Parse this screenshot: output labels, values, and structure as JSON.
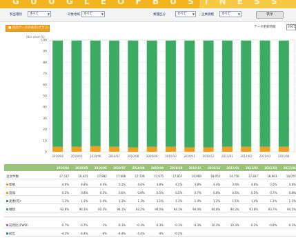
{
  "banner": {
    "text": "G U U G L E   O F   B U S I N E S S"
  },
  "filters": {
    "f1": {
      "label": "製品種別",
      "value": "すべて"
    },
    "f2": {
      "label": "対象地域",
      "value": "すべて"
    },
    "f3": {
      "label": "業種区分",
      "value": "すべて"
    },
    "f4": {
      "label": "企業規模",
      "value": "すべて"
    },
    "display_button": "表示"
  },
  "toolbar": {
    "orange_button": "■ 月次データの表示(グラフ)",
    "update_label": "データ更新時間",
    "update_value": "2015"
  },
  "chart_unit": "(Bar chart %)",
  "chart_data": {
    "type": "bar",
    "stacked": true,
    "categories": [
      "2010/04",
      "2010/05",
      "2010/06",
      "2010/07",
      "2010/08",
      "2010/09",
      "2010/10",
      "2010/11",
      "2010/12",
      "2011/01",
      "2011/02",
      "2011/03",
      "2011/04"
    ],
    "ylim": [
      0,
      100
    ],
    "yticks": [
      "100",
      "90",
      "80",
      "70",
      "60",
      "50",
      "40",
      "30",
      "20",
      "10",
      "0"
    ],
    "series": [
      {
        "name": "",
        "color": "#3cab63",
        "values": [
          95,
          95,
          94.5,
          95,
          95.5,
          95,
          95,
          95.5,
          95.5,
          95,
          95,
          95,
          95
        ]
      },
      {
        "name": "",
        "color": "#f0a020",
        "values": [
          4.5,
          4.5,
          5,
          4.5,
          4,
          4.5,
          4.5,
          4,
          4,
          4.5,
          4.5,
          4.5,
          4.5
        ]
      }
    ]
  },
  "table": {
    "columns": [
      "2010/04",
      "2010/05",
      "2010/06",
      "2010/07",
      "2010/08",
      "2010/09",
      "2010/10",
      "2010/11",
      "2010/12",
      "2011/01",
      "2011/02",
      "2011/03",
      "2011/04"
    ],
    "rows": [
      {
        "label": "注文件数",
        "dot": "",
        "values": [
          "17,537",
          "16,425",
          "17,882",
          "17,608",
          "17,739",
          "17,675",
          "17,857",
          "16,969",
          "18,055",
          "14,756",
          "17,837",
          "18,963",
          "18,055"
        ]
      },
      {
        "label": "新規",
        "dot": "#f0a020",
        "values": [
          "4.6%",
          "4.8%",
          "4.4%",
          "5.2%",
          "4.6%",
          "4.8%",
          "4.2%",
          "3.8%",
          "4.4%",
          "3.6%",
          "4.6%",
          "5.0%",
          "4.6%"
        ]
      },
      {
        "label": "追加",
        "dot": "#f0a020",
        "values": [
          "0.5%",
          "0.8%",
          "0.5%",
          "0.6%",
          "0.8%",
          "0.5%",
          "0.5%",
          "0.7%",
          "0.8%",
          "0.4%",
          "0.5%",
          "0.7%",
          "0.8%"
        ]
      },
      {
        "label": "変更(内)",
        "dot": "#3b7bd4",
        "values": [
          "1.3%",
          "1.1%",
          "1.4%",
          "1.2%",
          "1.3%",
          "1.1%",
          "1.3%",
          "1.4%",
          "1.2%",
          "1.5%",
          "1.4%",
          "1.2%",
          "1.1%"
        ]
      },
      {
        "label": "継続",
        "dot": "#3cab63",
        "values": [
          "92.8%",
          "94.3%",
          "93.3%",
          "94.1%",
          "93.2%",
          "94.0%",
          "94.1%",
          "94.0%",
          "94.8%",
          "94.2%",
          "93.8%",
          "93.7%",
          "94.1%"
        ]
      },
      {
        "label": "前月比(ZWD)",
        "dot": "#b45bd4",
        "values": [
          "-0.7%",
          "-0.7%",
          "-1%",
          "-0.1%",
          "-0.3%",
          "-0.3%",
          "-0.3%",
          "-0.3%",
          "-10.3%",
          "-10.3%",
          "-0.2%",
          "-0.8%",
          "-0.1%"
        ]
      },
      {
        "label": "前年",
        "dot": "#3b7bd4",
        "values": [
          "-4.4%",
          "-4.4%",
          "-4%",
          "-4.4%",
          "-4.4%",
          "-4%",
          "-0.2%",
          "",
          "",
          "",
          "",
          "",
          ""
        ]
      }
    ]
  }
}
